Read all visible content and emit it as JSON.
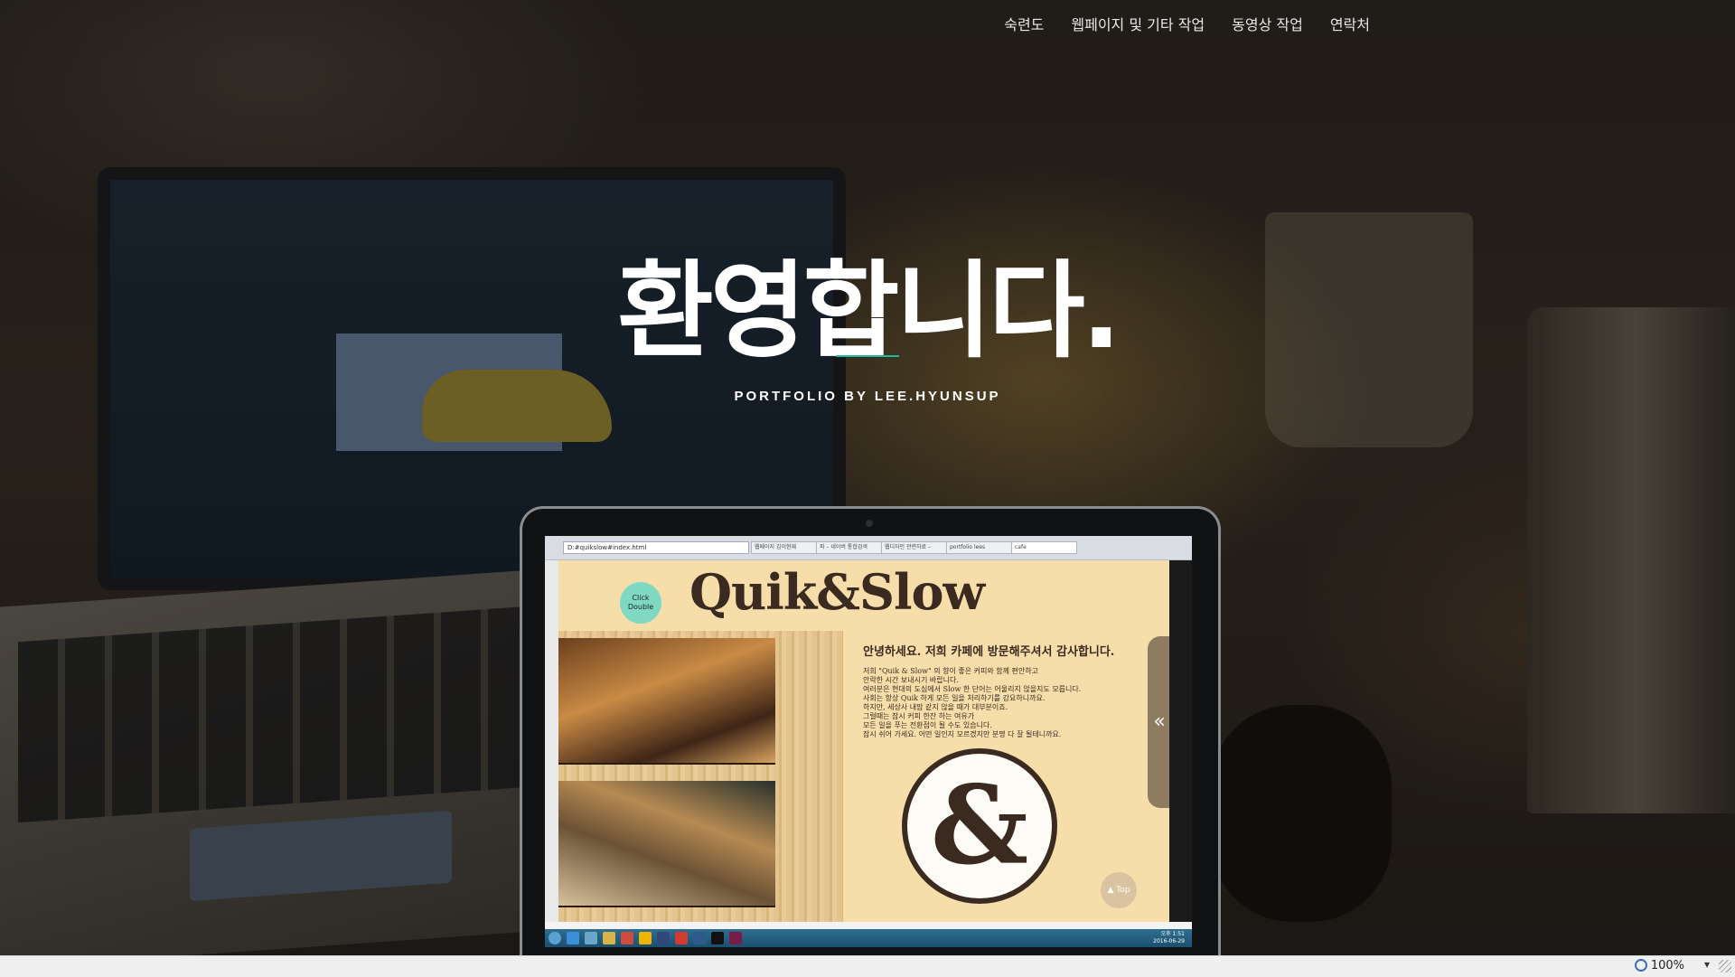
{
  "nav": {
    "items": [
      "숙련도",
      "웹페이지 및 기타 작업",
      "동영상 작업",
      "연락처"
    ]
  },
  "hero": {
    "title": "환영합니다.",
    "subtitle": "PORTFOLIO BY LEE.HYUNSUP",
    "accent_color": "#1fb89a"
  },
  "mockup": {
    "address": "D:#quikslow#index.html",
    "tabs": [
      "웹페이지 김이현재",
      "파 – 네이버 통합검색",
      "웹디자인 관련자료 – ",
      "portfolio lees",
      "cafe"
    ],
    "page": {
      "logo": "Quik&Slow",
      "click_badge": "Click Double",
      "greeting": "안녕하세요. 저희 카페에 방문해주셔서 감사합니다.",
      "body_lines": [
        "저희 \"Quik & Slow\" 의 향이 좋은 커피와 함께 편안하고",
        "안락한 시간 보내시기 바랍니다.",
        "여러분은 현대의 도심에서 Slow 한 단어는 어울리지 않을지도 모릅니다.",
        "사회는 항상 Quik 하게 모든 일을 처리하기를 강요하니까요.",
        "하지만, 세상사 내맘 같지 않을 때가 대부분이죠.",
        "그럴때는 잠시 커피 한잔 하는 여유가",
        "모든 일을 푸는 전환점이 될 수도 있습니다.",
        "잠시 쉬어 가세요. 어떤 일인지 모르겠지만 분명 다 잘 될테니까요."
      ],
      "emblem": "&",
      "side_tab": "«",
      "top_button": "▲ Top"
    },
    "clock": [
      "오후 1:51",
      "2016-06-29"
    ]
  },
  "statusbar": {
    "zoom": "100%"
  }
}
